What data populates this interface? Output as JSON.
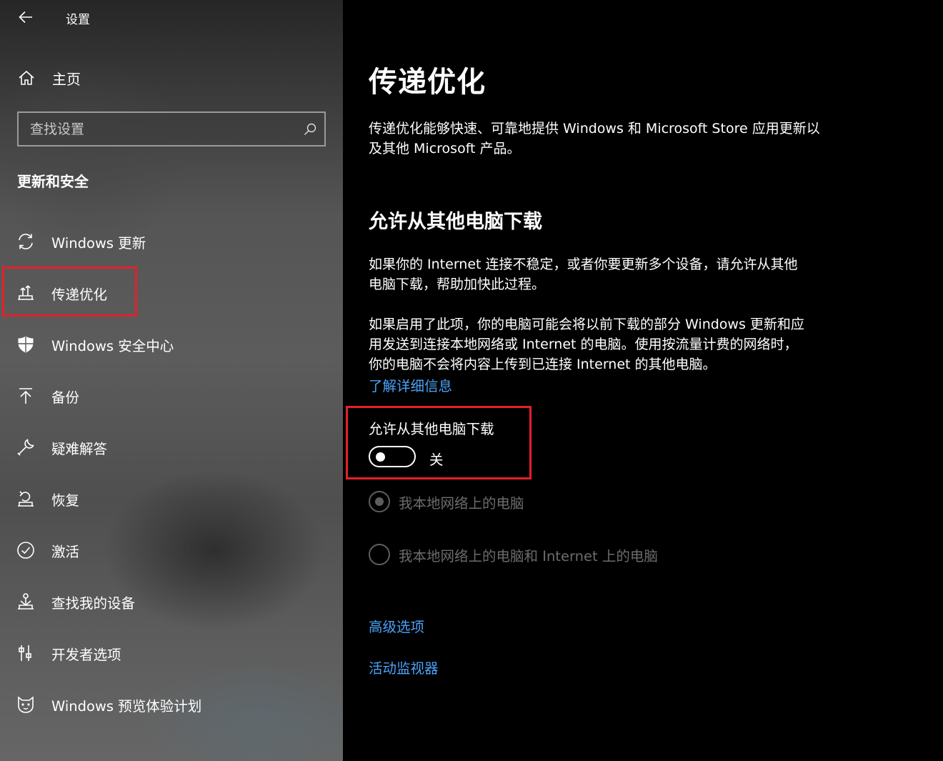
{
  "titlebar": {
    "back_icon": "back-arrow-icon",
    "title": "设置"
  },
  "sidebar": {
    "home": {
      "icon": "home-icon",
      "label": "主页"
    },
    "search": {
      "placeholder": "查找设置",
      "icon": "search-icon"
    },
    "section_title": "更新和安全",
    "items": [
      {
        "icon": "refresh-icon",
        "label": "Windows 更新"
      },
      {
        "icon": "delivery-optimization-icon",
        "label": "传递优化",
        "selected": true
      },
      {
        "icon": "shield-icon",
        "label": "Windows 安全中心"
      },
      {
        "icon": "backup-arrow-icon",
        "label": "备份"
      },
      {
        "icon": "wrench-icon",
        "label": "疑难解答"
      },
      {
        "icon": "recovery-icon",
        "label": "恢复"
      },
      {
        "icon": "check-circle-icon",
        "label": "激活"
      },
      {
        "icon": "find-device-icon",
        "label": "查找我的设备"
      },
      {
        "icon": "developer-icon",
        "label": "开发者选项"
      },
      {
        "icon": "insider-cat-icon",
        "label": "Windows 预览体验计划"
      }
    ]
  },
  "main": {
    "title": "传递优化",
    "description_line1": "传递优化能够快速、可靠地提供 Windows 和 Microsoft Store 应用更新以",
    "description_line2": "及其他 Microsoft 产品。",
    "subheading": "允许从其他电脑下载",
    "para1_line1": "如果你的 Internet 连接不稳定，或者你要更新多个设备，请允许从其他",
    "para1_line2": "电脑下载，帮助加快此过程。",
    "para2_line1": "如果启用了此项，你的电脑可能会将以前下载的部分 Windows 更新和应",
    "para2_line2": "用发送到连接本地网络或 Internet 的电脑。使用按流量计费的网络时，",
    "para2_line3": "你的电脑不会将内容上传到已连接 Internet 的其他电脑。",
    "learn_more": "了解详细信息",
    "toggle": {
      "label": "允许从其他电脑下载",
      "state": "关",
      "on": false
    },
    "radio_options": [
      {
        "label": "我本地网络上的电脑",
        "checked": true,
        "disabled": true
      },
      {
        "label": "我本地网络上的电脑和 Internet 上的电脑",
        "checked": false,
        "disabled": true
      }
    ],
    "advanced_options": "高级选项",
    "activity_monitor": "活动监视器"
  },
  "colors": {
    "link": "#4aa3f7",
    "highlight_box": "#e5202b",
    "disabled": "#6c6c6c"
  }
}
